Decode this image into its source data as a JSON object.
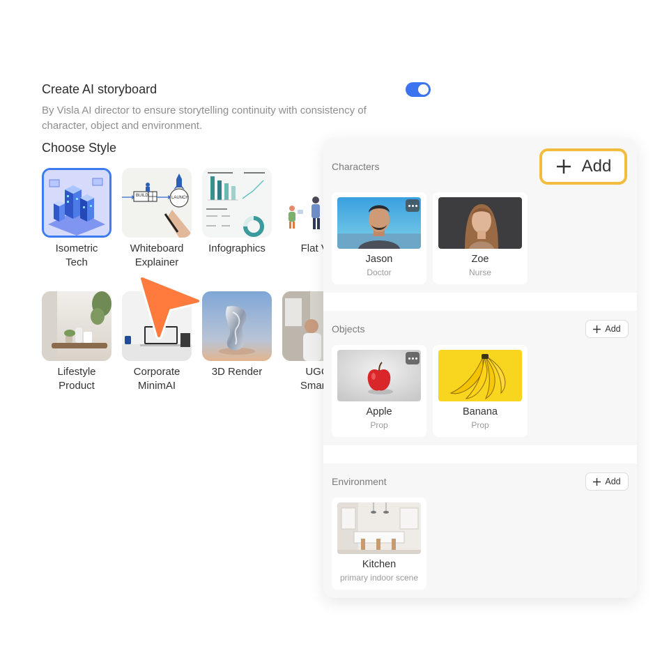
{
  "header": {
    "title": "Create AI storyboard",
    "description": "By Visla AI director to ensure storytelling continuity with consistency of character, object and environment.",
    "toggle_on": true,
    "toggle_color": "#3b74ee"
  },
  "styles": {
    "heading": "Choose Style",
    "items": [
      {
        "label": "Isometric\nTech",
        "selected": true
      },
      {
        "label": "Whiteboard\nExplainer",
        "selected": false
      },
      {
        "label": "Infographics",
        "selected": false
      },
      {
        "label": "Flat Ve",
        "selected": false
      },
      {
        "label": "Lifestyle\nProduct",
        "selected": false
      },
      {
        "label": "Corporate\nMinimAI",
        "selected": false
      },
      {
        "label": "3D Render",
        "selected": false
      },
      {
        "label": "UGC\nSmartp",
        "selected": false
      }
    ],
    "whiteboard_text": {
      "build": "BUILD",
      "launch": "LAUNCH"
    }
  },
  "panel": {
    "characters": {
      "label": "Characters",
      "add_label": "Add",
      "items": [
        {
          "name": "Jason",
          "role": "Doctor"
        },
        {
          "name": "Zoe",
          "role": "Nurse"
        }
      ]
    },
    "objects": {
      "label": "Objects",
      "add_label": "Add",
      "items": [
        {
          "name": "Apple",
          "role": "Prop"
        },
        {
          "name": "Banana",
          "role": "Prop"
        }
      ]
    },
    "environment": {
      "label": "Environment",
      "add_label": "Add",
      "items": [
        {
          "name": "Kitchen",
          "role": "primary indoor scene"
        }
      ]
    },
    "highlight_color": "#f2bd3f"
  },
  "cursor": {
    "color": "#ff7a3d"
  }
}
